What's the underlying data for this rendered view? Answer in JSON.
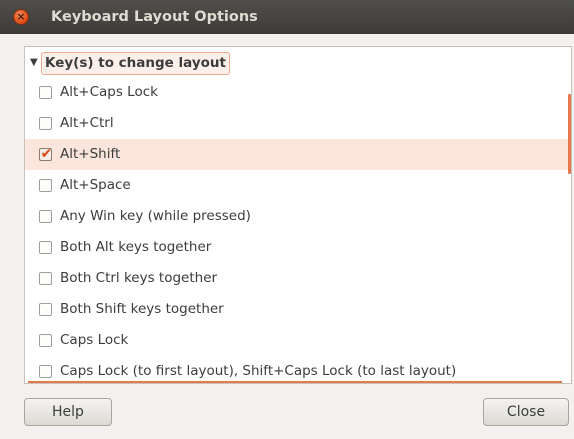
{
  "window": {
    "title": "Keyboard Layout Options",
    "close_glyph": "×"
  },
  "group": {
    "expander_glyph": "▼",
    "label": "Key(s) to change layout"
  },
  "options": [
    {
      "label": "Alt+Caps Lock",
      "checked": false
    },
    {
      "label": "Alt+Ctrl",
      "checked": false
    },
    {
      "label": "Alt+Shift",
      "checked": true
    },
    {
      "label": "Alt+Space",
      "checked": false
    },
    {
      "label": "Any Win key (while pressed)",
      "checked": false
    },
    {
      "label": "Both Alt keys together",
      "checked": false
    },
    {
      "label": "Both Ctrl keys together",
      "checked": false
    },
    {
      "label": "Both Shift keys together",
      "checked": false
    },
    {
      "label": "Caps Lock",
      "checked": false
    },
    {
      "label": "Caps Lock (to first layout), Shift+Caps Lock (to last layout)",
      "checked": false
    }
  ],
  "buttons": {
    "help": "Help",
    "close": "Close"
  },
  "colors": {
    "accent": "#dd4814",
    "titlebar": "#3c3b37",
    "selected_row": "#fbe5dc"
  }
}
